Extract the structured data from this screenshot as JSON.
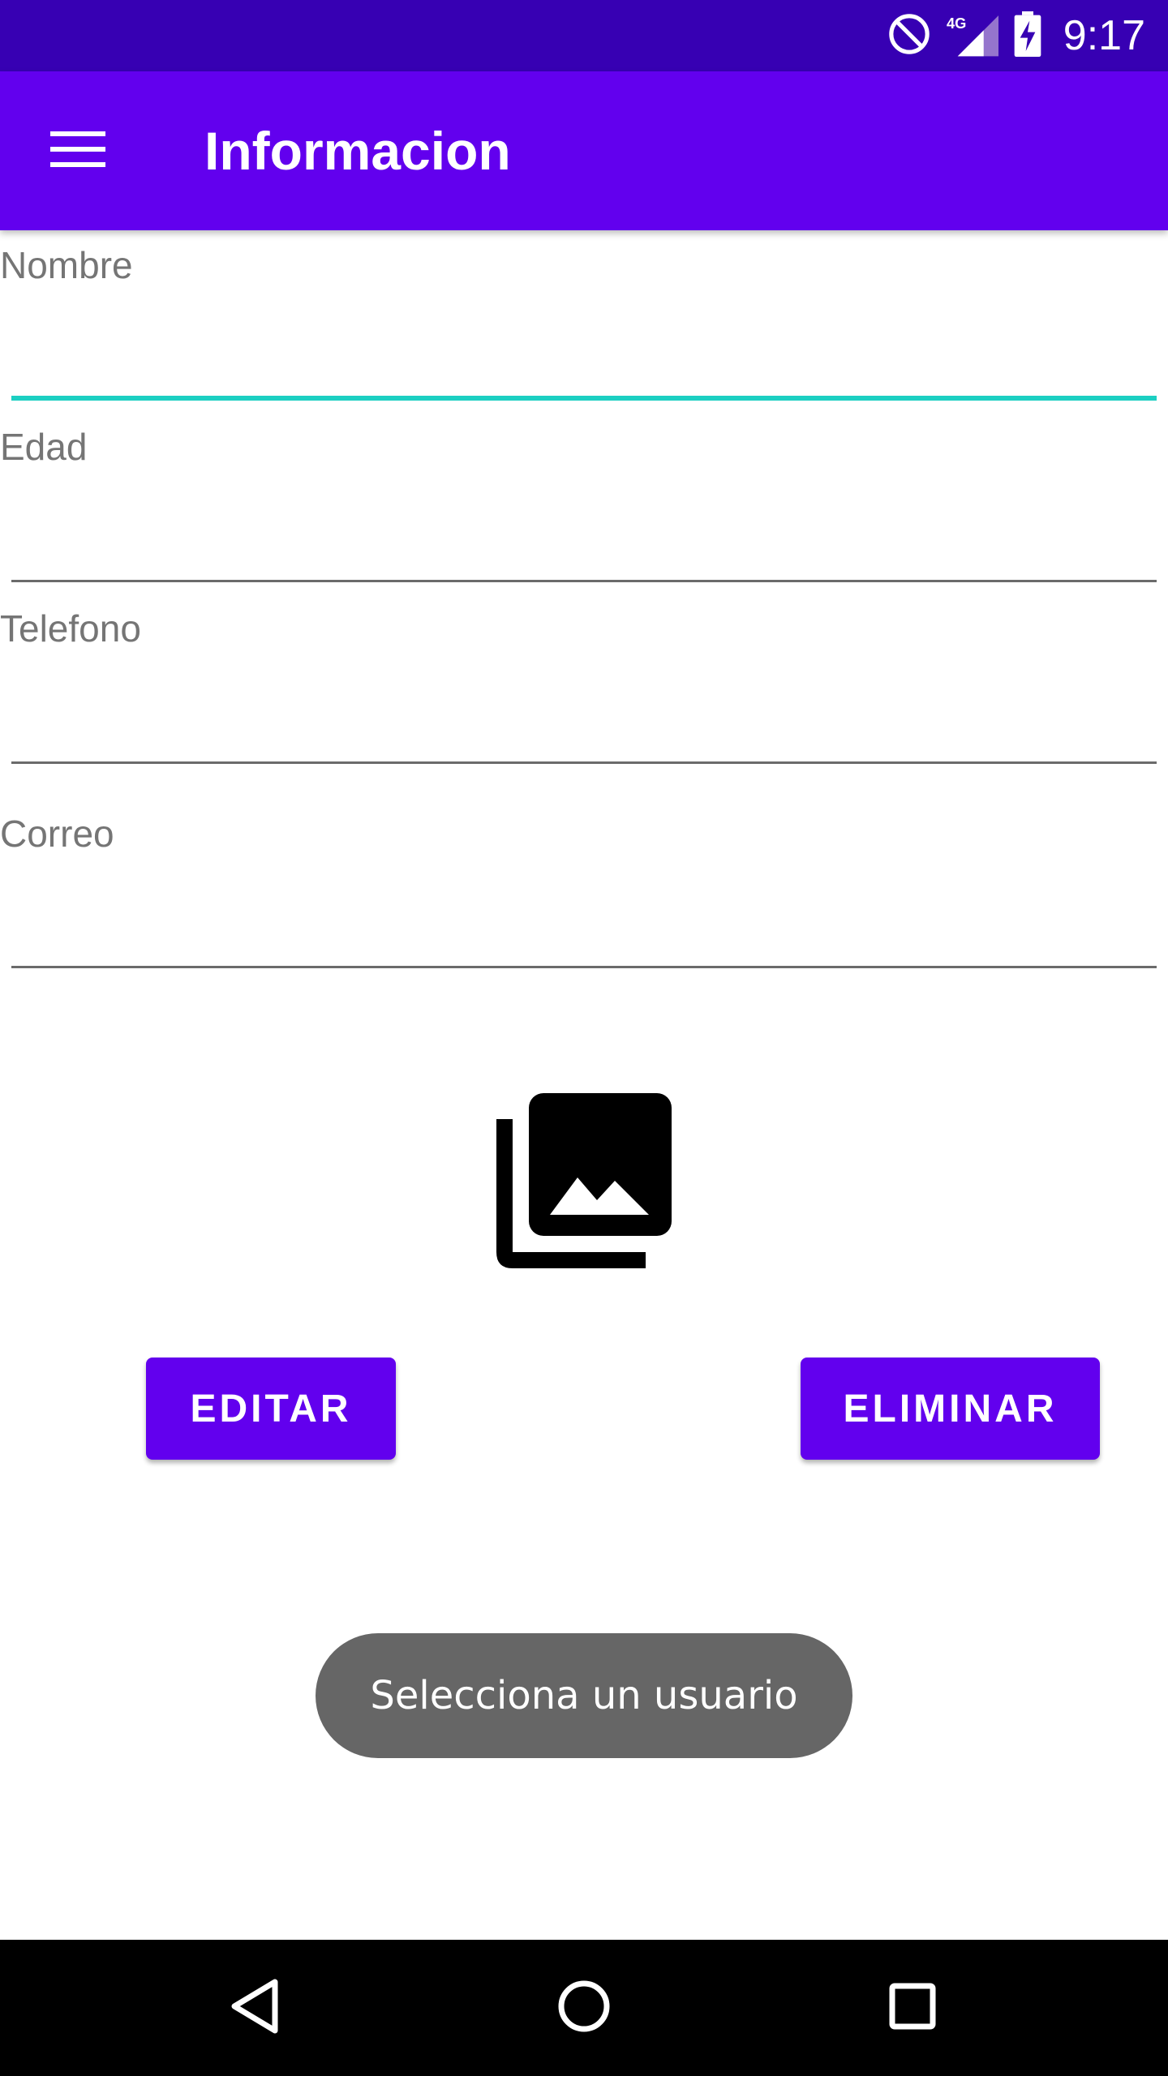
{
  "status_bar": {
    "time": "9:17",
    "network": "4G",
    "icons": [
      "do-not-disturb-icon",
      "signal-icon",
      "battery-charging-icon"
    ]
  },
  "app_bar": {
    "menu_icon": "menu-icon",
    "title": "Informacion"
  },
  "form": {
    "fields": [
      {
        "label": "Nombre",
        "value": "",
        "focused": true
      },
      {
        "label": "Edad",
        "value": ""
      },
      {
        "label": "Telefono",
        "value": ""
      },
      {
        "label": "Correo",
        "value": ""
      }
    ]
  },
  "image_placeholder": {
    "icon": "photo-library-icon"
  },
  "buttons": {
    "edit_label": "EDITAR",
    "delete_label": "ELIMINAR"
  },
  "toast": {
    "message": "Selecciona un usuario"
  },
  "nav_bar": {
    "icons": [
      "back-icon",
      "home-icon",
      "recent-apps-icon"
    ]
  },
  "colors": {
    "status_bar": "#3700B3",
    "primary": "#6200EE",
    "focus_accent": "#1CCFC2",
    "toast_bg": "#666666",
    "nav_bar": "#000000"
  }
}
